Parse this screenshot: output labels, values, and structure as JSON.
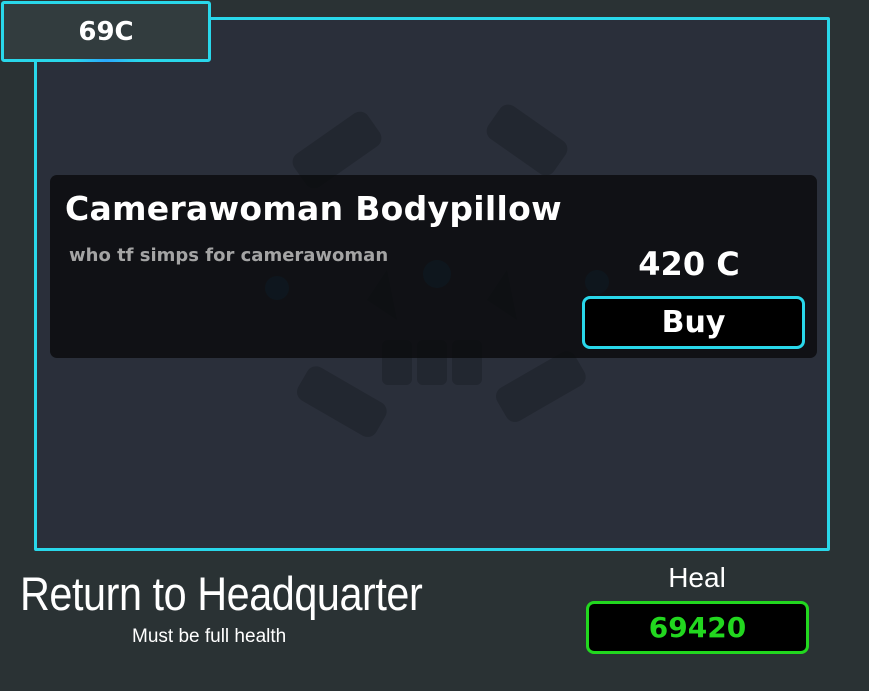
{
  "currency": {
    "display": "69C"
  },
  "shop": {
    "item": {
      "title": "Camerawoman Bodypillow",
      "description": "who tf simps for camerawoman",
      "price": "420 C",
      "buy_label": "Buy"
    }
  },
  "footer": {
    "return_title": "Return to Headquarter",
    "return_subtitle": "Must be full health",
    "heal_label": "Heal",
    "heal_cost": "69420"
  },
  "colors": {
    "accent": "#29d7ea",
    "heal": "#22d71f",
    "background": "#2a3234",
    "panel": "#2a2f3a"
  }
}
